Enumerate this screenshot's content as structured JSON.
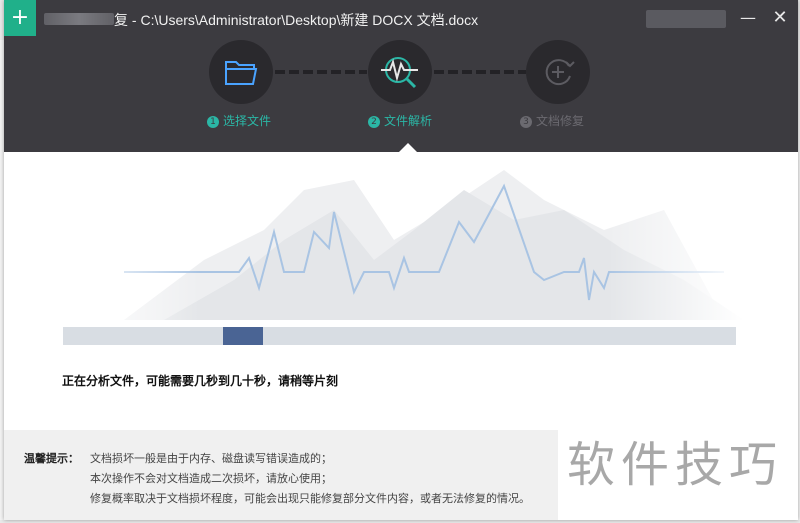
{
  "dialog": {
    "title": "C:\\Users\\Administrator\\Desktop\\新建 DOCX 文档.docx",
    "title_prefix": "复 -",
    "app_icon": "plus-icon",
    "minimize": "—",
    "close": "✕"
  },
  "steps": [
    {
      "num": "1",
      "label": "选择文件",
      "icon": "folder-icon",
      "state": "done"
    },
    {
      "num": "2",
      "label": "文件解析",
      "icon": "magnifier-pulse-icon",
      "state": "active"
    },
    {
      "num": "3",
      "label": "文档修复",
      "icon": "repair-cycle-icon",
      "state": "pending"
    }
  ],
  "progress": {
    "fraction": 0.24
  },
  "status_text": "正在分析文件，可能需要几秒到几十秒，请稍等片刻",
  "tips": {
    "label": "温馨提示：",
    "lines": [
      "文档损坏一般是由于内存、磁盘读写错误造成的；",
      "本次操作不会对文档造成二次损坏，请放心使用；",
      "修复概率取决于文档损坏程度，可能会出现只能修复部分文件内容，或者无法修复的情况。"
    ]
  },
  "watermark": "软件技巧",
  "colors": {
    "header": "#3c3b40",
    "accent": "#2bb7a6",
    "progress": "#4a6494",
    "wave": "#a9c4e3"
  }
}
